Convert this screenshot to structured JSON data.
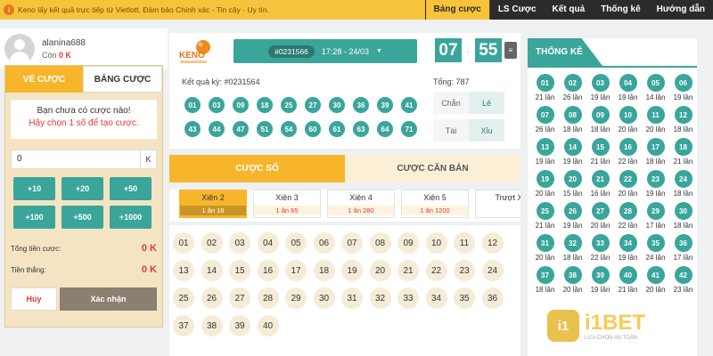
{
  "header": {
    "info_icon": "info-circle-icon",
    "info_text": "Keno lấy kết quả trực tiếp từ Vietlott. Đảm bảo Chính xác - Tin cậy - Uy tín.",
    "nav": [
      "Bảng cược",
      "LS Cược",
      "Kết quả",
      "Thống kê",
      "Hướng dẫn"
    ]
  },
  "user": {
    "name": "alanina688",
    "balance_label": "Còn",
    "balance_value": "0 K"
  },
  "bet_panel": {
    "tabs": [
      "VÉ CƯỢC",
      "BẢNG CƯỢC"
    ],
    "empty_line1": "Bạn chưa có cược nào!",
    "empty_line2": "Hãy chọn 1 số để tạo cược.",
    "amount_value": "0",
    "amount_unit": "K",
    "quick_amounts": [
      "+10",
      "+20",
      "+50",
      "+100",
      "+500",
      "+1000"
    ],
    "total_label": "Tổng tiền cược:",
    "total_value": "0 K",
    "win_label": "Tiền thắng:",
    "win_value": "0 K",
    "cancel_label": "Hủy",
    "confirm_label": "Xác nhận"
  },
  "draw": {
    "logo_text": "KENO",
    "draw_id": "#0231566",
    "time": "17:28 - 24/03",
    "timer_min": "07",
    "timer_sec": "55",
    "prev_label": "Kết quả kỳ: #0231564",
    "total_label": "Tổng: 787",
    "result_balls": [
      "01",
      "03",
      "09",
      "18",
      "25",
      "27",
      "30",
      "36",
      "39",
      "41",
      "43",
      "44",
      "47",
      "51",
      "54",
      "60",
      "61",
      "63",
      "64",
      "71"
    ],
    "chan": "Chẵn",
    "le": "Lẻ",
    "tai": "Tài",
    "xiu": "Xỉu"
  },
  "bet_types": {
    "tabs": [
      "CƯỢC SỐ",
      "CƯỢC CĂN BẢN"
    ],
    "xien": [
      {
        "name": "Xiên 2",
        "odds": "1 ăn 16"
      },
      {
        "name": "Xiên 3",
        "odds": "1 ăn 65"
      },
      {
        "name": "Xiên 4",
        "odds": "1 ăn 280"
      },
      {
        "name": "Xiên 5",
        "odds": "1 ăn 1200"
      },
      {
        "name": "Trượt X",
        "odds": ""
      }
    ],
    "numbers": [
      "01",
      "02",
      "03",
      "04",
      "05",
      "06",
      "07",
      "08",
      "09",
      "10",
      "11",
      "12",
      "13",
      "14",
      "15",
      "16",
      "17",
      "18",
      "19",
      "20",
      "21",
      "22",
      "23",
      "24",
      "25",
      "26",
      "27",
      "28",
      "29",
      "30",
      "31",
      "32",
      "33",
      "34",
      "35",
      "36",
      "37",
      "38",
      "39",
      "40"
    ]
  },
  "stats": {
    "title": "THỐNG KÊ",
    "items": [
      {
        "n": "01",
        "t": "21 lần"
      },
      {
        "n": "02",
        "t": "26 lần"
      },
      {
        "n": "03",
        "t": "19 lần"
      },
      {
        "n": "04",
        "t": "19 lần"
      },
      {
        "n": "05",
        "t": "14 lần"
      },
      {
        "n": "06",
        "t": "19 lần"
      },
      {
        "n": "07",
        "t": "26 lần"
      },
      {
        "n": "08",
        "t": "18 lần"
      },
      {
        "n": "09",
        "t": "18 lần"
      },
      {
        "n": "10",
        "t": "20 lần"
      },
      {
        "n": "11",
        "t": "20 lần"
      },
      {
        "n": "12",
        "t": "18 lần"
      },
      {
        "n": "13",
        "t": "19 lần"
      },
      {
        "n": "14",
        "t": "19 lần"
      },
      {
        "n": "15",
        "t": "21 lần"
      },
      {
        "n": "16",
        "t": "22 lần"
      },
      {
        "n": "17",
        "t": "18 lần"
      },
      {
        "n": "18",
        "t": "21 lần"
      },
      {
        "n": "19",
        "t": "20 lần"
      },
      {
        "n": "20",
        "t": "15 lần"
      },
      {
        "n": "21",
        "t": "16 lần"
      },
      {
        "n": "22",
        "t": "20 lần"
      },
      {
        "n": "23",
        "t": "19 lần"
      },
      {
        "n": "24",
        "t": "18 lần"
      },
      {
        "n": "25",
        "t": "21 lần"
      },
      {
        "n": "26",
        "t": "19 lần"
      },
      {
        "n": "27",
        "t": "20 lần"
      },
      {
        "n": "28",
        "t": "22 lần"
      },
      {
        "n": "29",
        "t": "17 lần"
      },
      {
        "n": "30",
        "t": "18 lần"
      },
      {
        "n": "31",
        "t": "20 lần"
      },
      {
        "n": "32",
        "t": "18 lần"
      },
      {
        "n": "33",
        "t": "22 lần"
      },
      {
        "n": "34",
        "t": "19 lần"
      },
      {
        "n": "35",
        "t": "24 lần"
      },
      {
        "n": "36",
        "t": "17 lần"
      },
      {
        "n": "37",
        "t": "18 lần"
      },
      {
        "n": "38",
        "t": "20 lần"
      },
      {
        "n": "39",
        "t": "19 lần"
      },
      {
        "n": "40",
        "t": "21 lần"
      },
      {
        "n": "41",
        "t": "20 lần"
      },
      {
        "n": "42",
        "t": "23 lần"
      }
    ]
  },
  "watermark": {
    "brand": "i1BET",
    "shield": "i1",
    "sub": "LỰA CHỌN AN TOÀN"
  }
}
